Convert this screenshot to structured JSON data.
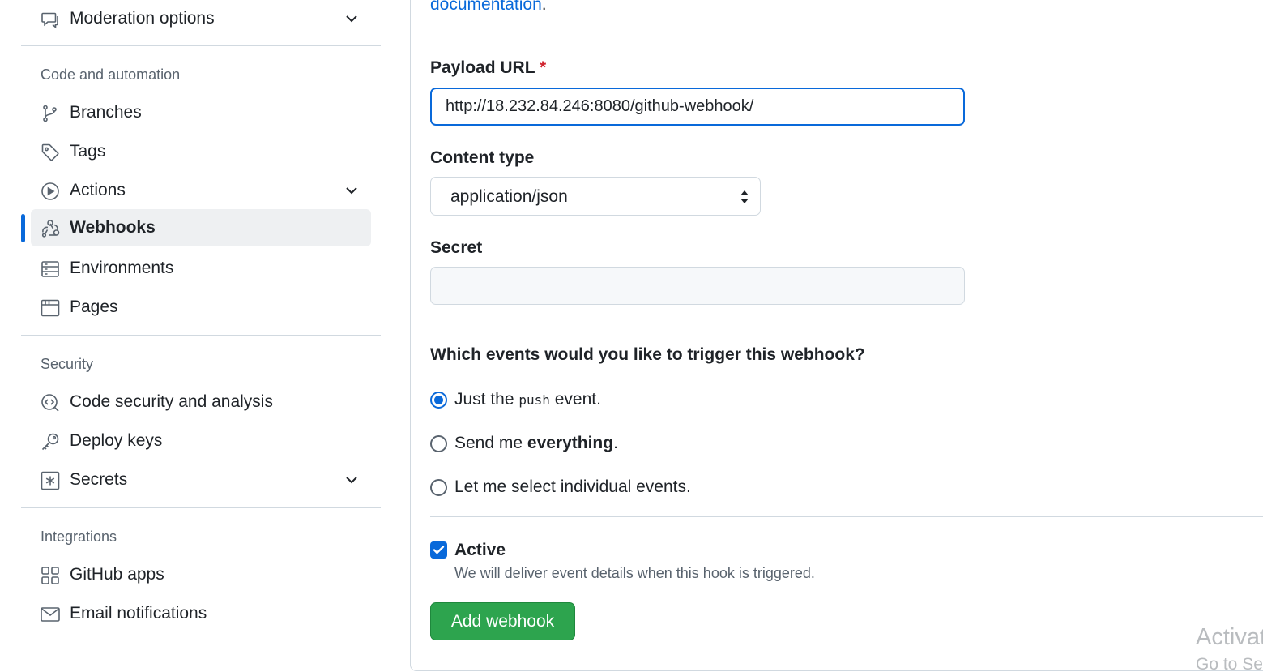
{
  "sidebar": {
    "top_item": {
      "label": "Moderation options",
      "icon": "report-icon",
      "expandable": true
    },
    "sections": [
      {
        "heading": "Code and automation",
        "items": [
          {
            "label": "Branches",
            "icon": "git-branch-icon"
          },
          {
            "label": "Tags",
            "icon": "tag-icon"
          },
          {
            "label": "Actions",
            "icon": "play-icon",
            "expandable": true
          },
          {
            "label": "Webhooks",
            "icon": "webhook-icon",
            "active": true
          },
          {
            "label": "Environments",
            "icon": "server-icon"
          },
          {
            "label": "Pages",
            "icon": "browser-icon"
          }
        ]
      },
      {
        "heading": "Security",
        "items": [
          {
            "label": "Code security and analysis",
            "icon": "codescan-icon"
          },
          {
            "label": "Deploy keys",
            "icon": "key-icon"
          },
          {
            "label": "Secrets",
            "icon": "key-asterisk-icon",
            "expandable": true
          }
        ]
      },
      {
        "heading": "Integrations",
        "items": [
          {
            "label": "GitHub apps",
            "icon": "apps-icon"
          },
          {
            "label": "Email notifications",
            "icon": "mail-icon"
          }
        ]
      }
    ]
  },
  "form": {
    "doc_link": "documentation",
    "doc_link_suffix": ".",
    "payload_url_label": "Payload URL",
    "required_mark": "*",
    "payload_url_value": "http://18.232.84.246:8080/github-webhook/",
    "content_type_label": "Content type",
    "content_type_value": "application/json",
    "secret_label": "Secret",
    "secret_value": "",
    "events_question": "Which events would you like to trigger this webhook?",
    "event_options": [
      {
        "pre": "Just the ",
        "code": "push",
        "post": " event.",
        "bold": "",
        "checked": true
      },
      {
        "pre": "Send me ",
        "code": "",
        "post": ".",
        "bold": "everything",
        "checked": false
      },
      {
        "pre": "Let me select individual events.",
        "code": "",
        "post": "",
        "bold": "",
        "checked": false
      }
    ],
    "active_label": "Active",
    "active_checked": true,
    "active_help": "We will deliver event details when this hook is triggered.",
    "submit_label": "Add webhook"
  },
  "watermark": {
    "line1": "Activat",
    "line2": "Go to Se"
  },
  "colors": {
    "accent": "#0969da",
    "primary_button": "#2da44e",
    "required": "#d1242f",
    "muted": "#59636e",
    "border": "#d1d9e0"
  }
}
